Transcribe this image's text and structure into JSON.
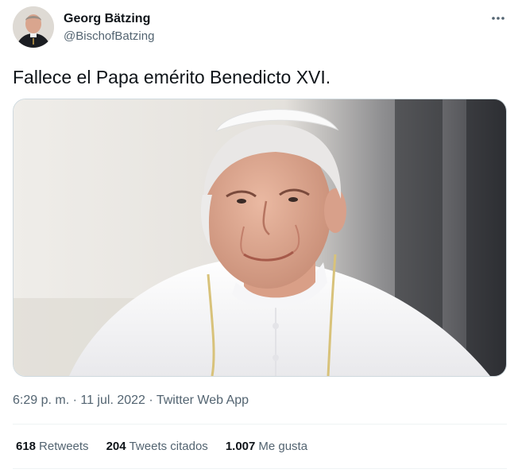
{
  "author": {
    "display_name": "Georg Bätzing",
    "handle": "@BischofBatzing"
  },
  "more_icon": "more-horizontal-icon",
  "tweet": {
    "text": "Fallece el Papa emérito Benedicto XVI."
  },
  "meta": {
    "time": "6:29 p. m.",
    "date": "11 jul. 2022",
    "source": "Twitter Web App",
    "separator": " · "
  },
  "stats": {
    "retweets_count": "618",
    "retweets_label": "Retweets",
    "quotes_count": "204",
    "quotes_label": "Tweets citados",
    "likes_count": "1.007",
    "likes_label": "Me gusta"
  },
  "colors": {
    "text_primary": "#0f1419",
    "text_secondary": "#536471",
    "border": "#cfd9de",
    "divider": "#eff3f4"
  }
}
